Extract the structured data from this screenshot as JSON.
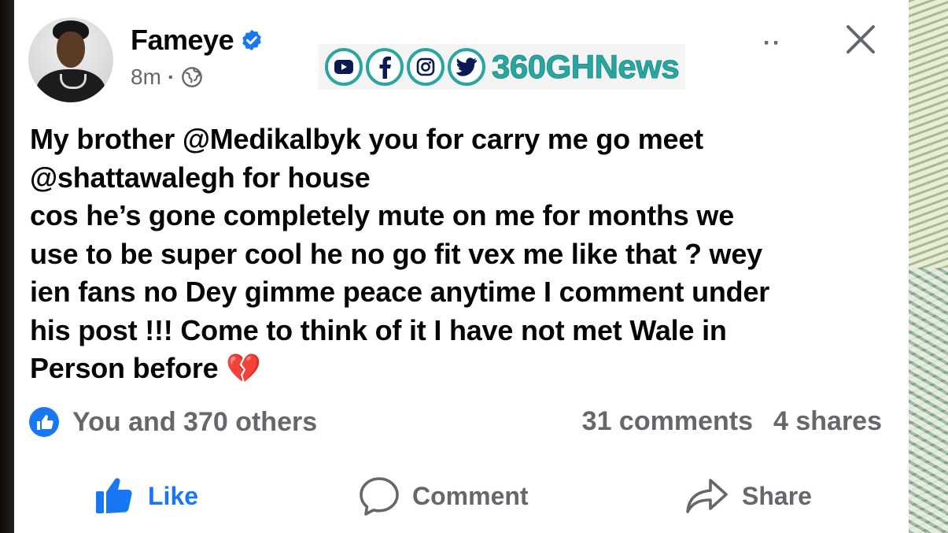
{
  "post": {
    "author": "Fameye",
    "time": "8m",
    "separator": "·",
    "text": "My brother @Medikalbyk you for carry me go meet\n@shattawalegh for house\ncos he’s gone completely mute on me for months we\nuse to be super cool he no go fit vex me like that ? wey\nien fans no Dey gimme peace anytime I comment under\nhis post !!! Come to think of it I have not met  Wale in\nPerson  before ",
    "emoji": "💔"
  },
  "watermark": {
    "text": "360GHNews",
    "icons": [
      "youtube-icon",
      "facebook-icon",
      "instagram-icon",
      "twitter-icon"
    ],
    "color": "#2aa5a0"
  },
  "reactions": {
    "summary": "You and 370 others",
    "comments": "31 comments",
    "shares": "4 shares"
  },
  "actions": {
    "like": "Like",
    "comment": "Comment",
    "share": "Share"
  },
  "colors": {
    "accent": "#1877f2",
    "muted": "#65676b",
    "text": "#050505"
  }
}
